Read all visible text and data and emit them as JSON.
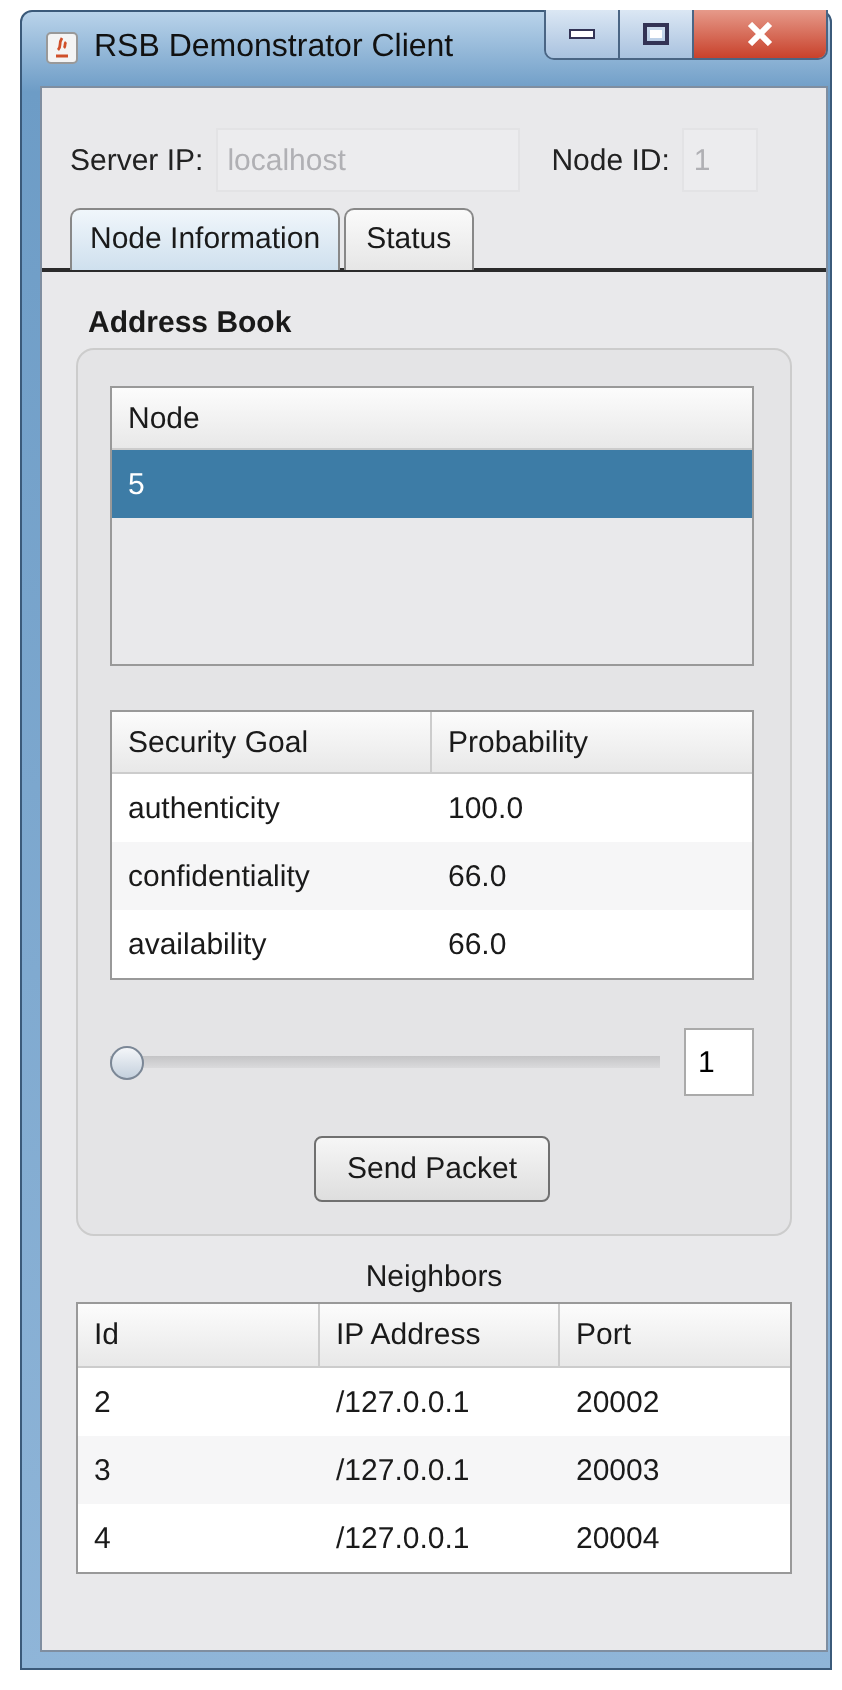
{
  "window": {
    "title": "RSB Demonstrator Client"
  },
  "server": {
    "label": "Server IP:",
    "value": "localhost",
    "disabled": true
  },
  "node_id": {
    "label": "Node ID:",
    "value": "1",
    "disabled": true
  },
  "tabs": [
    {
      "label": "Node Information",
      "selected": true
    },
    {
      "label": "Status",
      "selected": false
    }
  ],
  "address_book": {
    "title": "Address Book",
    "node_table": {
      "columns": [
        "Node"
      ],
      "rows": [
        {
          "cells": [
            "5"
          ],
          "selected": true
        }
      ]
    },
    "goal_table": {
      "columns": [
        "Security Goal",
        "Probability"
      ],
      "rows": [
        {
          "cells": [
            "authenticity",
            "100.0"
          ],
          "selected": false
        },
        {
          "cells": [
            "confidentiality",
            "66.0"
          ],
          "selected": false
        },
        {
          "cells": [
            "availability",
            "66.0"
          ],
          "selected": false
        }
      ]
    },
    "slider": {
      "level": 0
    },
    "spinner": {
      "value": "1"
    },
    "button": "Send Packet"
  },
  "neighbors": {
    "title": "Neighbors",
    "columns": [
      "Id",
      "IP Address",
      "Port"
    ],
    "rows": [
      {
        "cells": [
          "2",
          "/127.0.0.1",
          "20002"
        ],
        "selected": false
      },
      {
        "cells": [
          "3",
          "/127.0.0.1",
          "20003"
        ],
        "selected": false
      },
      {
        "cells": [
          "4",
          "/127.0.0.1",
          "20004"
        ],
        "selected": false
      }
    ]
  }
}
